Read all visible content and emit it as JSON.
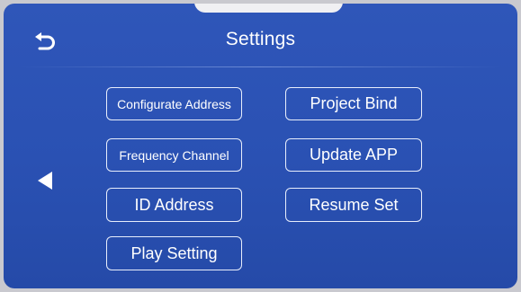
{
  "header": {
    "title": "Settings",
    "back_icon": "back-arrow-icon"
  },
  "navigation": {
    "prev_icon": "triangle-left-icon"
  },
  "menu": {
    "left_column": [
      {
        "label": "Configurate Address"
      },
      {
        "label": "Frequency Channel"
      },
      {
        "label": "ID Address"
      },
      {
        "label": "Play Setting"
      }
    ],
    "right_column": [
      {
        "label": "Project Bind"
      },
      {
        "label": "Update APP"
      },
      {
        "label": "Resume Set"
      }
    ]
  },
  "colors": {
    "screen_background": "#2a51b3",
    "button_border": "#e8eefc",
    "text": "#ffffff",
    "frame": "#c9c9cf"
  }
}
